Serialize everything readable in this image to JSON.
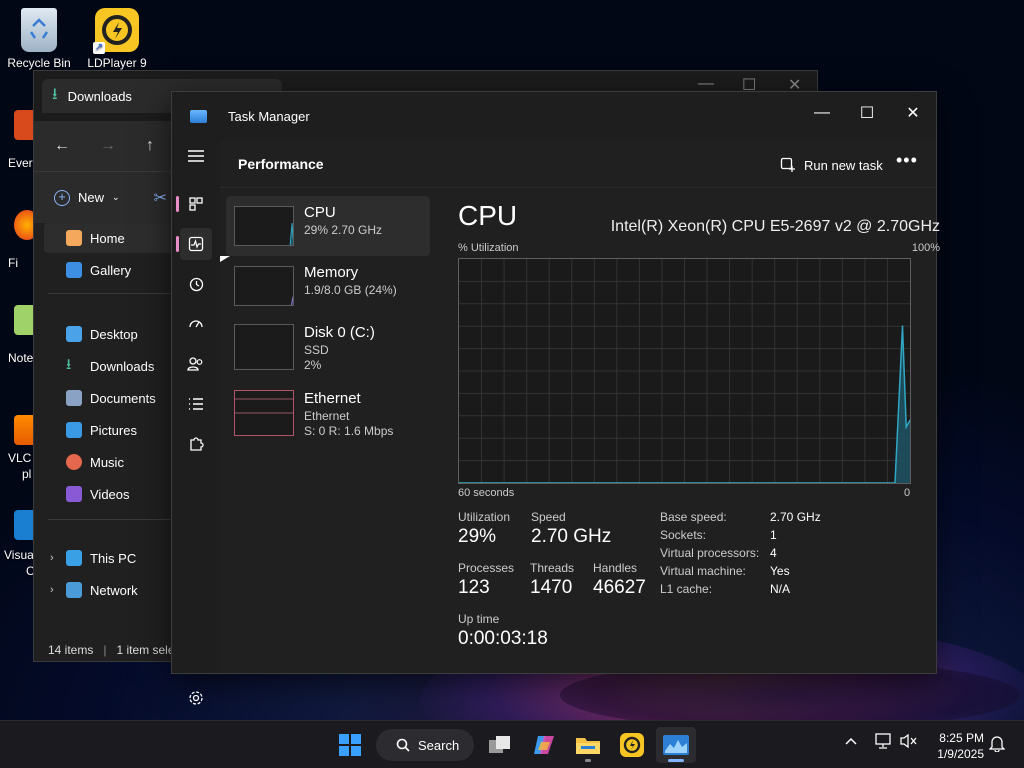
{
  "desktop": {
    "icons": [
      {
        "label": "Recycle Bin",
        "icon": "recycle-bin-icon"
      },
      {
        "label": "LDPlayer 9",
        "icon": "ldplayer-icon"
      }
    ],
    "partial_icons": [
      {
        "label": "Ever",
        "icon": "app-icon"
      },
      {
        "label": "Fi",
        "icon": "firefox-icon"
      },
      {
        "label": "Note",
        "icon": "notepad-icon"
      },
      {
        "label": "VLC",
        "label2": "pl",
        "icon": "vlc-icon"
      },
      {
        "label": "Visua",
        "label2": "C",
        "icon": "vscode-icon"
      }
    ]
  },
  "explorer": {
    "tab_title": "Downloads",
    "new_label": "New",
    "sidebar": [
      {
        "label": "Home",
        "icon": "home-icon"
      },
      {
        "label": "Gallery",
        "icon": "gallery-icon"
      },
      {
        "label": "Desktop",
        "icon": "desktop-icon"
      },
      {
        "label": "Downloads",
        "icon": "downloads-icon"
      },
      {
        "label": "Documents",
        "icon": "documents-icon"
      },
      {
        "label": "Pictures",
        "icon": "pictures-icon"
      },
      {
        "label": "Music",
        "icon": "music-icon"
      },
      {
        "label": "Videos",
        "icon": "videos-icon"
      },
      {
        "label": "This PC",
        "icon": "this-pc-icon"
      },
      {
        "label": "Network",
        "icon": "network-icon"
      }
    ],
    "status_items": "14 items",
    "status_selected": "1 item selec"
  },
  "task_manager": {
    "title": "Task Manager",
    "page_title": "Performance",
    "run_new_task": "Run new task",
    "more_symbol": "•••",
    "resources": [
      {
        "name": "CPU",
        "sub1": "29%  2.70 GHz",
        "sub2": ""
      },
      {
        "name": "Memory",
        "sub1": "1.9/8.0 GB (24%)",
        "sub2": ""
      },
      {
        "name": "Disk 0 (C:)",
        "sub1": "SSD",
        "sub2": "2%"
      },
      {
        "name": "Ethernet",
        "sub1": "Ethernet",
        "sub2": "S: 0  R: 1.6 Mbps"
      }
    ],
    "detail": {
      "heading": "CPU",
      "model": "Intel(R) Xeon(R) CPU E5-2697 v2 @ 2.70GHz",
      "graph_top_left": "% Utilization",
      "graph_top_right": "100%",
      "graph_bottom_left": "60 seconds",
      "graph_bottom_right": "0",
      "stats": {
        "utilization_label": "Utilization",
        "utilization_value": "29%",
        "speed_label": "Speed",
        "speed_value": "2.70 GHz",
        "processes_label": "Processes",
        "processes_value": "123",
        "threads_label": "Threads",
        "threads_value": "1470",
        "handles_label": "Handles",
        "handles_value": "46627",
        "uptime_label": "Up time",
        "uptime_value": "0:00:03:18"
      },
      "specs": [
        {
          "key": "Base speed:",
          "value": "2.70 GHz"
        },
        {
          "key": "Sockets:",
          "value": "1"
        },
        {
          "key": "Virtual processors:",
          "value": "4"
        },
        {
          "key": "Virtual machine:",
          "value": "Yes"
        },
        {
          "key": "L1 cache:",
          "value": "N/A"
        }
      ]
    }
  },
  "chart_data": {
    "type": "area",
    "title": "% Utilization",
    "xlabel": "60 seconds",
    "ylabel": "",
    "ylim": [
      0,
      100
    ],
    "xlim": [
      60,
      0
    ],
    "grid": true,
    "series": [
      {
        "x": [
          60,
          2.0,
          1.0,
          0.5,
          0
        ],
        "values": [
          0,
          0,
          70,
          25,
          28
        ]
      }
    ]
  },
  "taskbar": {
    "search_label": "Search",
    "time": "8:25 PM",
    "date": "1/9/2025"
  },
  "colors": {
    "accent_pink": "#ea8ec7",
    "cpu_graph_fill": "#1f5566",
    "cpu_graph_line": "#2fa7c4"
  }
}
